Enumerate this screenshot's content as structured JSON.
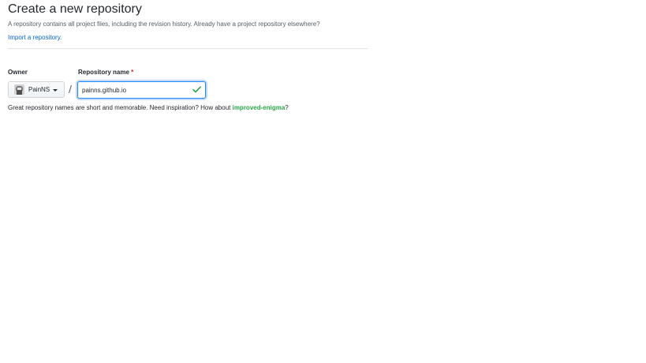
{
  "header": {
    "title": "Create a new repository",
    "description": "A repository contains all project files, including the revision history. Already have a project repository elsewhere?",
    "import_link": "Import a repository."
  },
  "form": {
    "owner_label": "Owner",
    "repo_label": "Repository name",
    "required_marker": "*",
    "owner_name": "PainNS",
    "separator": "/",
    "repo_value": "painns.github.io",
    "repo_valid_icon": "check-icon",
    "hint_text": "Great repository names are short and memorable. Need inspiration? How about ",
    "suggestion": "improved-enigma",
    "hint_end": "?"
  },
  "colors": {
    "link": "#0366d6",
    "suggestion": "#28a745",
    "required": "#cb2431",
    "focus_border": "#2188ff",
    "check": "#28a745"
  }
}
